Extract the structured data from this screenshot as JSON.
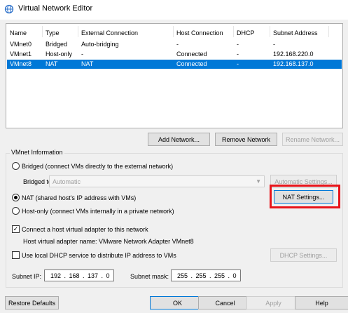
{
  "window": {
    "title": "Virtual Network Editor",
    "icon": "network-globe-icon"
  },
  "network_list": {
    "columns": [
      "Name",
      "Type",
      "External Connection",
      "Host Connection",
      "DHCP",
      "Subnet Address"
    ],
    "rows": [
      {
        "name": "VMnet0",
        "type": "Bridged",
        "external": "Auto-bridging",
        "host": "-",
        "dhcp": "-",
        "subnet": "-"
      },
      {
        "name": "VMnet1",
        "type": "Host-only",
        "external": "-",
        "host": "Connected",
        "dhcp": "-",
        "subnet": "192.168.220.0"
      },
      {
        "name": "VMnet8",
        "type": "NAT",
        "external": "NAT",
        "host": "Connected",
        "dhcp": "-",
        "subnet": "192.168.137.0"
      }
    ],
    "selected_row": "VMnet8"
  },
  "list_buttons": {
    "add": "Add Network...",
    "remove": "Remove Network",
    "rename": "Rename Network..."
  },
  "vmnet_info": {
    "group_label": "VMnet Information",
    "bridged_label": "Bridged (connect VMs directly to the external network)",
    "bridged_to_label": "Bridged to:",
    "bridged_to_value": "Automatic",
    "automatic_settings": "Automatic Settings...",
    "nat_label": "NAT (shared host's IP address with VMs)",
    "nat_settings": "NAT Settings...",
    "hostonly_label": "Host-only (connect VMs internally in a private network)",
    "connect_adapter_label": "Connect a host virtual adapter to this network",
    "adapter_name_label": "Host virtual adapter name: VMware Network Adapter VMnet8",
    "dhcp_label": "Use local DHCP service to distribute IP address to VMs",
    "dhcp_settings": "DHCP Settings...",
    "subnet_ip_label": "Subnet IP:",
    "subnet_ip_value": "192 . 168 . 137 .  0",
    "subnet_mask_label": "Subnet mask:",
    "subnet_mask_value": "255 . 255 . 255 .  0",
    "selected_mode": "NAT",
    "connect_adapter_checked": true,
    "dhcp_checked": false
  },
  "footer": {
    "restore": "Restore Defaults",
    "ok": "OK",
    "cancel": "Cancel",
    "apply": "Apply",
    "help": "Help"
  },
  "annotation_color": "#e8141a",
  "selection_color": "#0078d7"
}
